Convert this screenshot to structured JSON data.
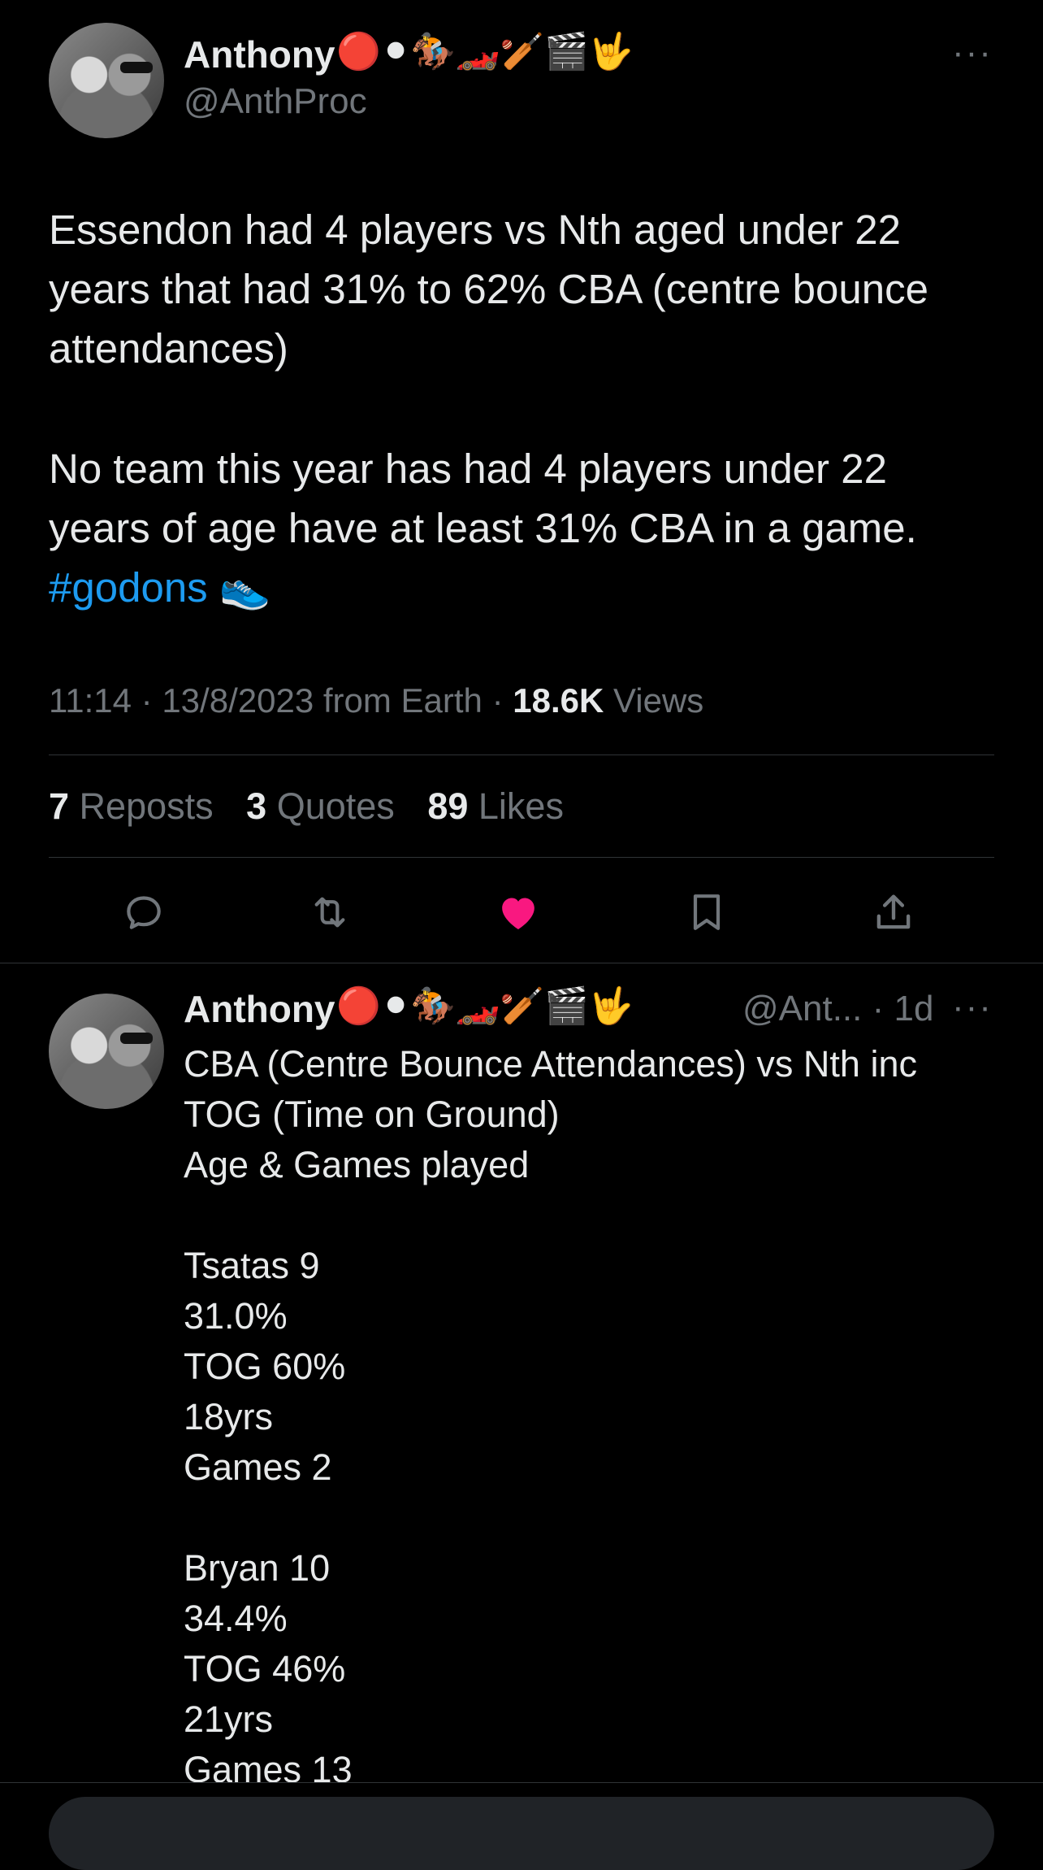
{
  "main_tweet": {
    "display_name": "Anthony",
    "name_emojis": "🔴⚫🏇🏎️🏏🎬🤟",
    "handle": "@AnthProc",
    "text_paragraph_1": "Essendon had 4 players vs Nth aged under 22 years that had 31% to 62% CBA (centre bounce attendances)",
    "text_paragraph_2": "No team this year has had 4 players under 22 years of age have at least 31% CBA in a game.",
    "hashtag": "#godons",
    "hashtag_emoji": "👟",
    "time": "11:14",
    "date": "13/8/2023",
    "source": "from Earth",
    "views_count": "18.6K",
    "views_label": "Views",
    "reposts_count": "7",
    "reposts_label": "Reposts",
    "quotes_count": "3",
    "quotes_label": "Quotes",
    "likes_count": "89",
    "likes_label": "Likes",
    "liked": true,
    "more_glyph": "···",
    "colors": {
      "like": "#f91880",
      "link": "#1d9bf0",
      "muted": "#71767b"
    }
  },
  "reply_tweet": {
    "display_name": "Anthony",
    "name_emojis": "🔴⚫🏇🏎️🏏🎬🤟",
    "handle": "@Ant...",
    "age": "· 1d",
    "more_glyph": "···",
    "text": "CBA (Centre Bounce Attendances) vs Nth inc\nTOG (Time on Ground)\nAge & Games played\n\nTsatas 9\n31.0%\nTOG 60%\n18yrs\nGames 2\n\nBryan 10\n34.4%\nTOG 46%\n21yrs\nGames 13"
  },
  "icons": [
    "reply-icon",
    "repost-icon",
    "like-icon",
    "bookmark-icon",
    "share-icon"
  ]
}
